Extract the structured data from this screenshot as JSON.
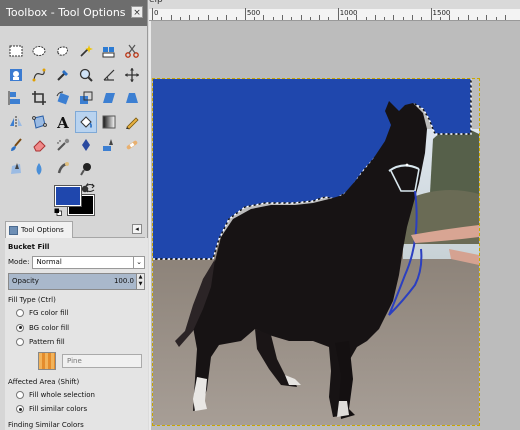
{
  "toolbox": {
    "title": "Toolbox - Tool Options",
    "close": "×"
  },
  "tools": [
    "rect-select",
    "ellipse-select",
    "free-select",
    "fuzzy-select",
    "select-by-color",
    "scissors-select",
    "foreground-select",
    "paths",
    "color-picker",
    "zoom",
    "measure",
    "move",
    "align",
    "crop",
    "rotate",
    "scale",
    "shear",
    "perspective",
    "flip",
    "cage-transform",
    "text",
    "bucket-fill",
    "blend",
    "pencil",
    "paintbrush",
    "eraser",
    "airbrush",
    "ink",
    "clone",
    "heal",
    "perspective-clone",
    "blur",
    "smudge",
    "dodge-burn"
  ],
  "active_tool": "bucket-fill",
  "colors": {
    "fg": "#1f47ad",
    "bg": "#000000"
  },
  "options": {
    "tab_label": "Tool Options",
    "dock_arrow": "◂",
    "tool_name": "Bucket Fill",
    "mode_label": "Mode:",
    "mode_value": "Normal",
    "mode_arrow": "⌄",
    "opacity_label": "Opacity",
    "opacity_value": "100.0",
    "fill_type_label": "Fill Type  (Ctrl)",
    "fill_types": [
      "FG color fill",
      "BG color fill",
      "Pattern fill"
    ],
    "fill_type_selected": 1,
    "pattern_name": "Pine",
    "affected_label": "Affected Area  (Shift)",
    "affected": [
      "Fill whole selection",
      "Fill similar colors"
    ],
    "affected_selected": 1,
    "finding_label": "Finding Similar Colors"
  },
  "menu_fragment": "elp",
  "ruler": {
    "labels": [
      "0",
      "500",
      "1000",
      "1500"
    ]
  },
  "accent": "#1f47ad"
}
